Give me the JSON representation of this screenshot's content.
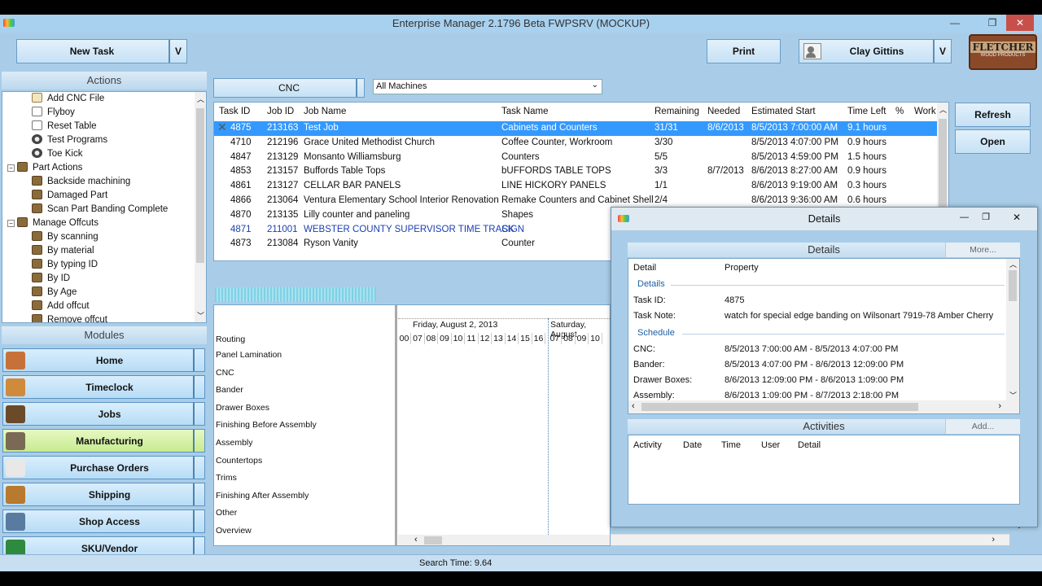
{
  "window": {
    "title": "Enterprise Manager 2.1796 Beta FWPSRV (MOCKUP)",
    "controls": {
      "minimize": "—",
      "restore": "❐",
      "close": "✕"
    }
  },
  "toolbar": {
    "new_task": "New Task",
    "dropdown_glyph": "V",
    "print": "Print",
    "user": "Clay Gittins",
    "refresh": "Refresh",
    "open": "Open",
    "logo_text": "FLETCHER",
    "logo_subtext": "WOOD PRODUCTS"
  },
  "actions": {
    "header": "Actions",
    "items": [
      {
        "label": "Add CNC File",
        "icon": "document-icon",
        "level": 2
      },
      {
        "label": "Flyboy",
        "icon": "page-icon",
        "level": 2
      },
      {
        "label": "Reset Table",
        "icon": "page-icon",
        "level": 2
      },
      {
        "label": "Test Programs",
        "icon": "gear-icon",
        "level": 2
      },
      {
        "label": "Toe Kick",
        "icon": "gear-icon",
        "level": 2
      },
      {
        "label": "Part Actions",
        "icon": "folder-icon",
        "level": 1,
        "expander": "−"
      },
      {
        "label": "Backside machining",
        "icon": "folder-icon",
        "level": 2
      },
      {
        "label": "Damaged Part",
        "icon": "folder-icon",
        "level": 2
      },
      {
        "label": "Scan Part Banding Complete",
        "icon": "folder-icon",
        "level": 2
      },
      {
        "label": "Manage Offcuts",
        "icon": "folder-icon",
        "level": 1,
        "expander": "−"
      },
      {
        "label": "By scanning",
        "icon": "folder-icon",
        "level": 2
      },
      {
        "label": "By material",
        "icon": "folder-icon",
        "level": 2
      },
      {
        "label": "By typing ID",
        "icon": "folder-icon",
        "level": 2
      },
      {
        "label": "By ID",
        "icon": "folder-icon",
        "level": 2
      },
      {
        "label": "By Age",
        "icon": "folder-icon",
        "level": 2
      },
      {
        "label": "Add offcut",
        "icon": "folder-icon",
        "level": 2
      },
      {
        "label": "Remove offcut",
        "icon": "folder-icon",
        "level": 2
      }
    ]
  },
  "modules": {
    "header": "Modules",
    "items": [
      {
        "label": "Home",
        "icon": "home-icon",
        "color": "#c7713a"
      },
      {
        "label": "Timeclock",
        "icon": "clock-icon",
        "color": "#d08a3c"
      },
      {
        "label": "Jobs",
        "icon": "briefcase-icon",
        "color": "#6b4a2a"
      },
      {
        "label": "Manufacturing",
        "icon": "factory-icon",
        "color": "#7a6a55",
        "active": true
      },
      {
        "label": "Purchase Orders",
        "icon": "form-icon",
        "color": "#e8e8e8"
      },
      {
        "label": "Shipping",
        "icon": "truck-icon",
        "color": "#b77a2e"
      },
      {
        "label": "Shop Access",
        "icon": "person-icon",
        "color": "#5a7ba0"
      },
      {
        "label": "SKU/Vendor",
        "icon": "barcode-icon",
        "color": "#2e8a3e"
      }
    ]
  },
  "filters": {
    "machine_group": "CNC",
    "machine": "All Machines"
  },
  "tasks": {
    "columns": [
      "Task ID",
      "Job ID",
      "Job Name",
      "Task Name",
      "Remaining",
      "Needed",
      "Estimated Start",
      "Time Left",
      "%",
      "Work"
    ],
    "rows": [
      {
        "task_id": "4875",
        "job_id": "213163",
        "job_name": "Test Job",
        "task_name": "Cabinets and Counters",
        "remaining": "31/31",
        "needed": "8/6/2013",
        "est_start": "8/5/2013 7:00:00 AM",
        "time_left": "9.1 hours",
        "selected": true
      },
      {
        "task_id": "4710",
        "job_id": "212196",
        "job_name": "Grace United Methodist Church",
        "task_name": "Coffee Counter, Workroom",
        "remaining": "3/30",
        "needed": "",
        "est_start": "8/5/2013 4:07:00 PM",
        "time_left": "0.9 hours"
      },
      {
        "task_id": "4847",
        "job_id": "213129",
        "job_name": "Monsanto Williamsburg",
        "task_name": "Counters",
        "remaining": "5/5",
        "needed": "",
        "est_start": "8/5/2013 4:59:00 PM",
        "time_left": "1.5 hours"
      },
      {
        "task_id": "4853",
        "job_id": "213157",
        "job_name": "Buffords Table Tops",
        "task_name": "bUFFORDS TABLE TOPS",
        "remaining": "3/3",
        "needed": "8/7/2013",
        "est_start": "8/6/2013 8:27:00 AM",
        "time_left": "0.9 hours"
      },
      {
        "task_id": "4861",
        "job_id": "213127",
        "job_name": "CELLAR BAR PANELS",
        "task_name": "LINE HICKORY PANELS",
        "remaining": "1/1",
        "needed": "",
        "est_start": "8/6/2013 9:19:00 AM",
        "time_left": "0.3 hours"
      },
      {
        "task_id": "4866",
        "job_id": "213064",
        "job_name": "Ventura Elementary School Interior Renovation",
        "task_name": "Remake Counters and Cabinet Shell",
        "remaining": "2/4",
        "needed": "",
        "est_start": "8/6/2013 9:36:00 AM",
        "time_left": "0.6 hours"
      },
      {
        "task_id": "4870",
        "job_id": "213135",
        "job_name": "Lilly counter and paneling",
        "task_name": "Shapes",
        "remaining": "",
        "needed": "",
        "est_start": "",
        "time_left": ""
      },
      {
        "task_id": "4871",
        "job_id": "211001",
        "job_name": "WEBSTER COUNTY SUPERVISOR TIME TRACK",
        "task_name": "SIGN",
        "remaining": "",
        "needed": "",
        "est_start": "",
        "time_left": "",
        "blue": true
      },
      {
        "task_id": "4873",
        "job_id": "213084",
        "job_name": "Ryson Vanity",
        "task_name": "Counter",
        "remaining": "",
        "needed": "",
        "est_start": "",
        "time_left": ""
      }
    ]
  },
  "gantt": {
    "routing_header": "Routing",
    "day1": "Friday, August 2, 2013",
    "day2": "Saturday, August",
    "hours1": [
      "00",
      "07",
      "08",
      "09",
      "10",
      "11",
      "12",
      "13",
      "14",
      "15",
      "16"
    ],
    "hours2": [
      "07",
      "08",
      "09",
      "10"
    ],
    "routes": [
      "Panel Lamination",
      "CNC",
      "Bander",
      "Drawer Boxes",
      "Finishing Before Assembly",
      "Assembly",
      "Countertops",
      "Trims",
      "Finishing After Assembly",
      "Other",
      "Overview"
    ]
  },
  "details": {
    "title": "Details",
    "section_title": "Details",
    "more_link": "More...",
    "col_detail": "Detail",
    "col_property": "Property",
    "group_details": "Details",
    "task_id_label": "Task ID:",
    "task_id_value": "4875",
    "task_note_label": "Task Note:",
    "task_note_value": "watch for special edge banding on Wilsonart 7919-78 Amber Cherry",
    "group_schedule": "Schedule",
    "schedule": [
      {
        "label": "CNC:",
        "value": "8/5/2013 7:00:00 AM - 8/5/2013 4:07:00 PM"
      },
      {
        "label": "Bander:",
        "value": "8/5/2013 4:07:00 PM - 8/6/2013 12:09:00 PM"
      },
      {
        "label": "Drawer Boxes:",
        "value": "8/6/2013 12:09:00 PM - 8/6/2013 1:09:00 PM"
      },
      {
        "label": "Assembly:",
        "value": "8/6/2013 1:09:00 PM - 8/7/2013 2:18:00 PM"
      }
    ],
    "activities_title": "Activities",
    "add_link": "Add...",
    "activity_columns": [
      "Activity",
      "Date",
      "Time",
      "User",
      "Detail"
    ]
  },
  "status": {
    "search_time": "Search Time: 9.64"
  },
  "colors": {
    "app_background": "#a9cde8",
    "selection": "#3399ff",
    "active_module": "#c8eb8f",
    "title_bar": "#a8d1ef"
  }
}
